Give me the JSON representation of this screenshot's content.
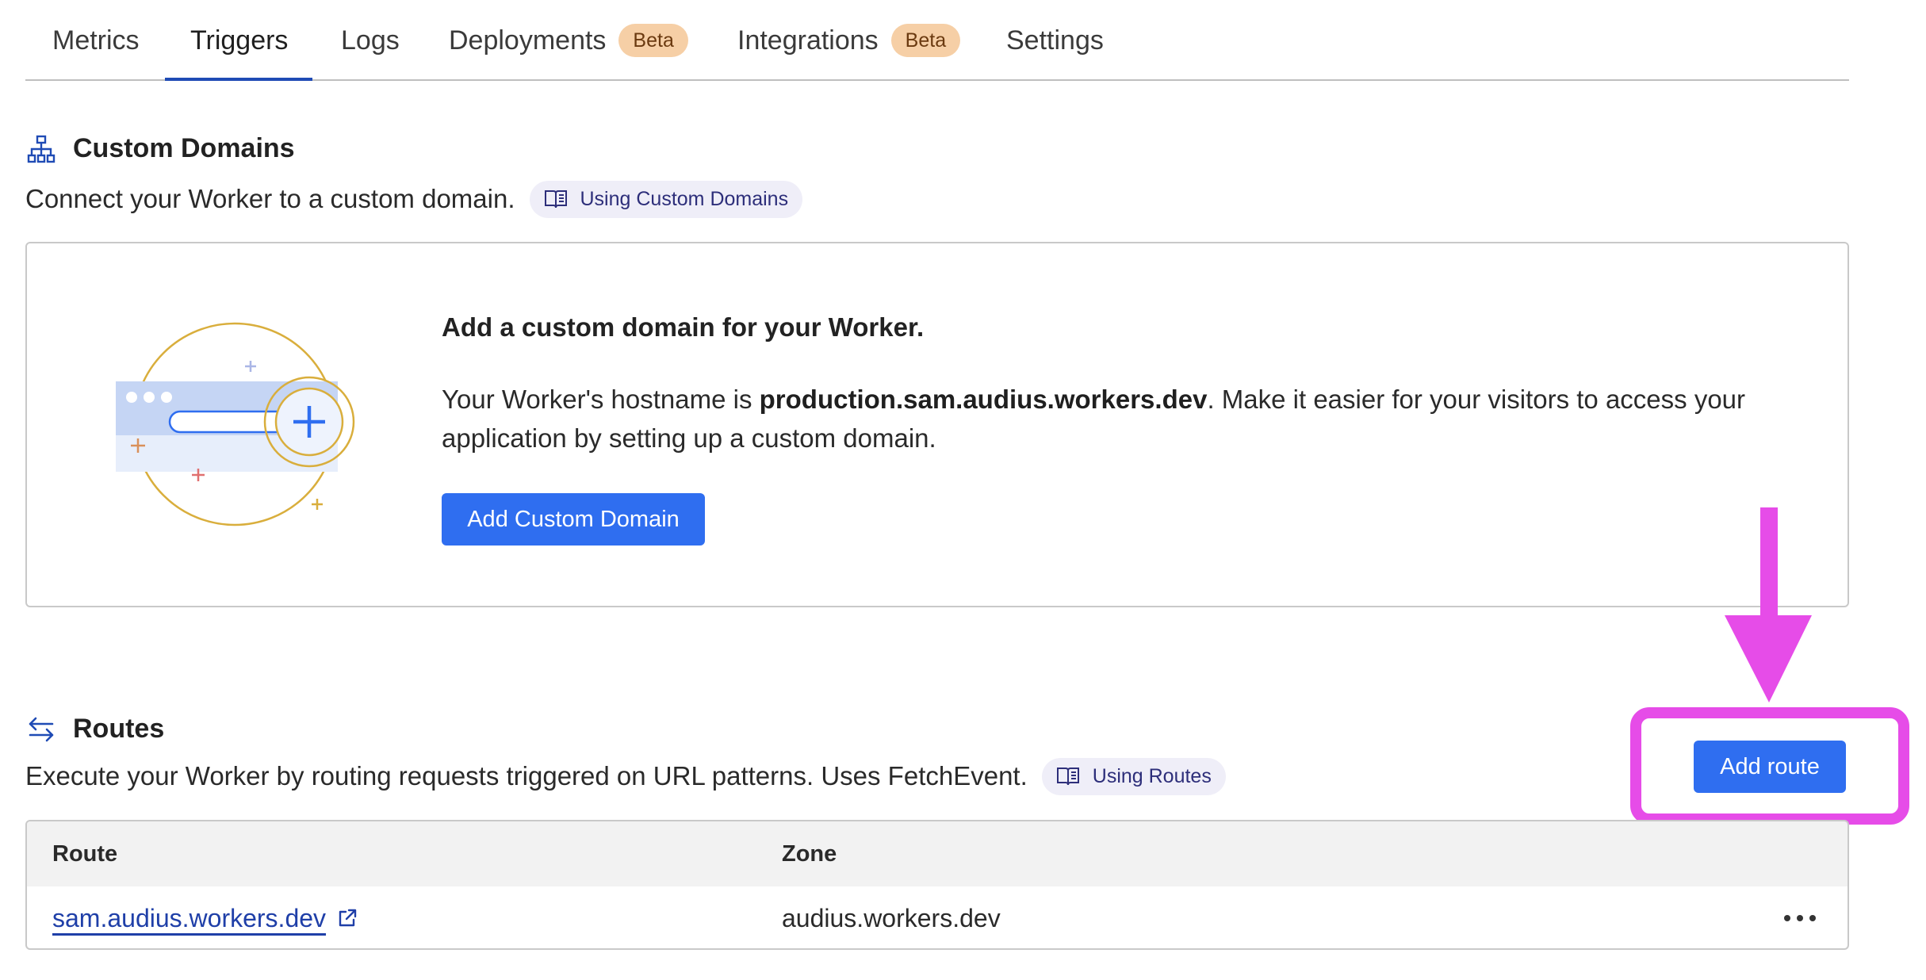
{
  "tabs": [
    {
      "label": "Metrics"
    },
    {
      "label": "Triggers",
      "active": true
    },
    {
      "label": "Logs"
    },
    {
      "label": "Deployments",
      "badge": "Beta"
    },
    {
      "label": "Integrations",
      "badge": "Beta"
    },
    {
      "label": "Settings"
    }
  ],
  "custom_domains": {
    "title": "Custom Domains",
    "description": "Connect your Worker to a custom domain.",
    "doc_link": "Using Custom Domains",
    "card": {
      "heading": "Add a custom domain for your Worker.",
      "text_prefix": "Your Worker's hostname is ",
      "hostname": "production.sam.audius.workers.dev",
      "text_suffix": ". Make it easier for your visitors to access your application by setting up a custom domain.",
      "button": "Add Custom Domain"
    }
  },
  "routes": {
    "title": "Routes",
    "description": "Execute your Worker by routing requests triggered on URL patterns. Uses FetchEvent.",
    "doc_link": "Using Routes",
    "add_button": "Add route",
    "columns": [
      "Route",
      "Zone"
    ],
    "rows": [
      {
        "route": "sam.audius.workers.dev",
        "zone": "audius.workers.dev"
      }
    ]
  },
  "colors": {
    "accent": "#2f6ef0",
    "annotation": "#e64ce8",
    "badge": "#f6cfa6"
  },
  "icons": {
    "custom_domains": "sitemap-icon",
    "routes": "swap-arrows-icon",
    "docs": "book-icon",
    "external": "external-link-icon",
    "more": "more-horizontal-icon"
  }
}
